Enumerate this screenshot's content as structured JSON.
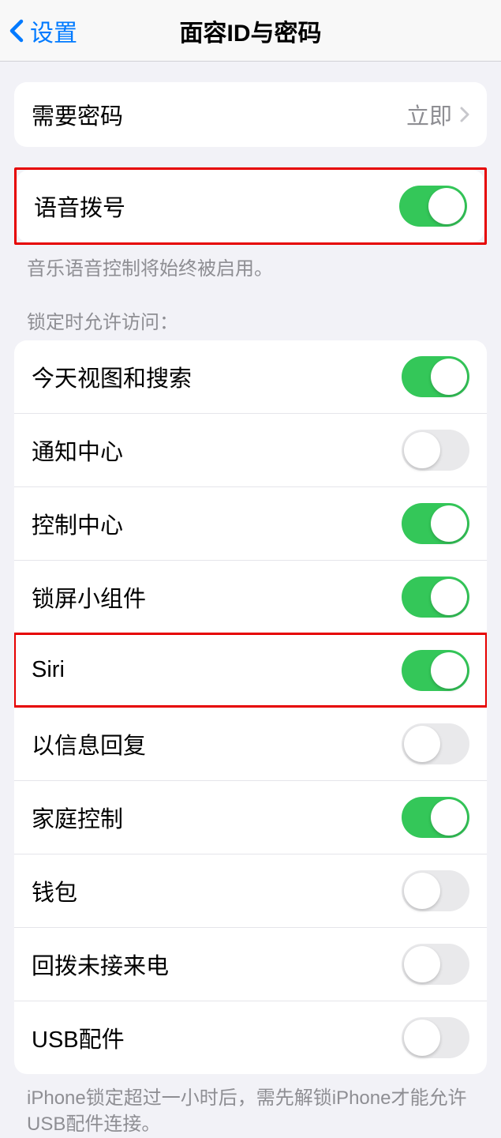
{
  "nav": {
    "back": "设置",
    "title": "面容ID与密码"
  },
  "passcode": {
    "label": "需要密码",
    "value": "立即"
  },
  "voiceDial": {
    "label": "语音拨号",
    "on": true,
    "footer": "音乐语音控制将始终被启用。"
  },
  "lockSection": {
    "header": "锁定时允许访问：",
    "items": [
      {
        "label": "今天视图和搜索",
        "on": true,
        "name": "today-view-toggle",
        "highlight": false
      },
      {
        "label": "通知中心",
        "on": false,
        "name": "notification-center-toggle",
        "highlight": false
      },
      {
        "label": "控制中心",
        "on": true,
        "name": "control-center-toggle",
        "highlight": false
      },
      {
        "label": "锁屏小组件",
        "on": true,
        "name": "lock-widgets-toggle",
        "highlight": false
      },
      {
        "label": "Siri",
        "on": true,
        "name": "siri-toggle",
        "highlight": true
      },
      {
        "label": "以信息回复",
        "on": false,
        "name": "reply-message-toggle",
        "highlight": false
      },
      {
        "label": "家庭控制",
        "on": true,
        "name": "home-control-toggle",
        "highlight": false
      },
      {
        "label": "钱包",
        "on": false,
        "name": "wallet-toggle",
        "highlight": false
      },
      {
        "label": "回拨未接来电",
        "on": false,
        "name": "callback-toggle",
        "highlight": false
      },
      {
        "label": "USB配件",
        "on": false,
        "name": "usb-accessories-toggle",
        "highlight": false
      }
    ],
    "footer": "iPhone锁定超过一小时后，需先解锁iPhone才能允许USB配件连接。"
  }
}
